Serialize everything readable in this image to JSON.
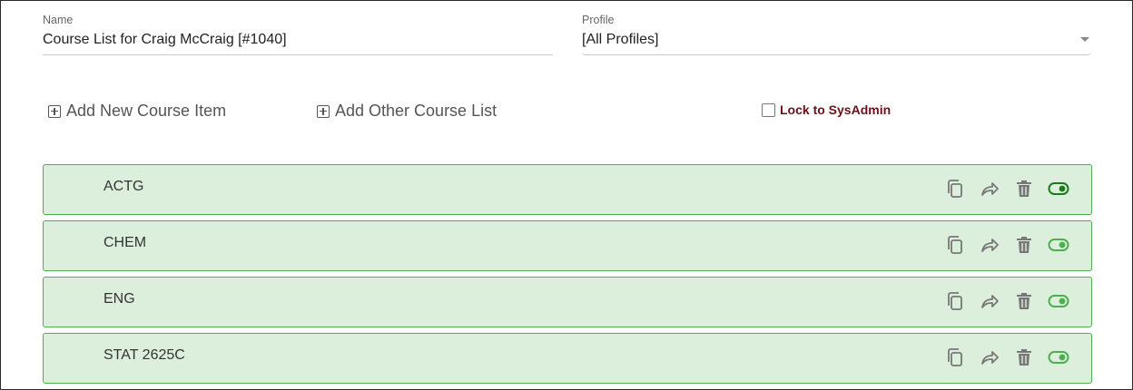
{
  "form": {
    "name_label": "Name",
    "name_value": "Course List for Craig McCraig [#1040]",
    "profile_label": "Profile",
    "profile_value": "[All Profiles]"
  },
  "actions": {
    "add_course_item": "Add New Course Item",
    "add_other_list": "Add Other Course List",
    "lock_label": "Lock to SysAdmin",
    "lock_checked": false
  },
  "courses": [
    {
      "name": "ACTG",
      "enabled": true
    },
    {
      "name": "CHEM",
      "enabled": true
    },
    {
      "name": "ENG",
      "enabled": true
    },
    {
      "name": "STAT 2625C",
      "enabled": true
    }
  ],
  "icons": {
    "copy": "copy-icon",
    "move": "share-arrow-icon",
    "delete": "trash-icon",
    "toggle": "toggle-icon"
  },
  "colors": {
    "row_background": "#dcefdc",
    "row_border": "#4caf50",
    "toggle_active": "#1b7a1b",
    "toggle": "#4caf50",
    "lock_text": "#6b0f1a"
  }
}
